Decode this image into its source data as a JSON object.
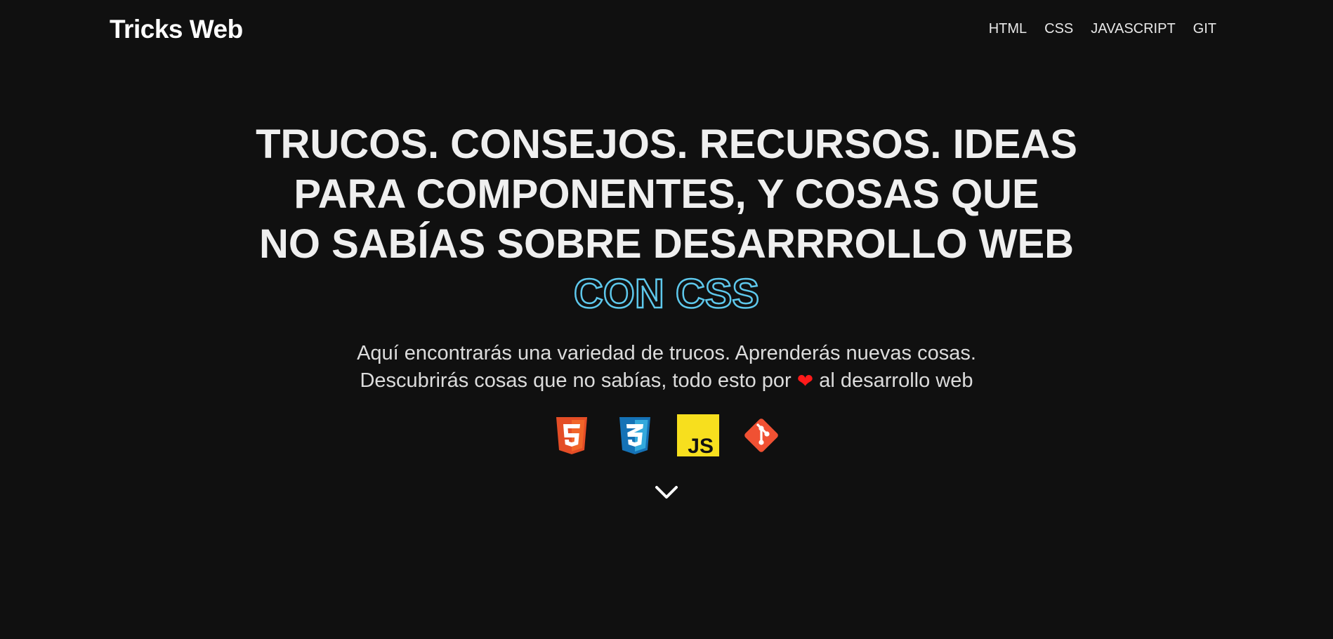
{
  "header": {
    "logo": "Tricks Web",
    "nav": [
      "HTML",
      "CSS",
      "JAVASCRIPT",
      "GIT"
    ]
  },
  "hero": {
    "headline_lines": [
      "TRUCOS. CONSEJOS. RECURSOS. IDEAS",
      "PARA COMPONENTES, Y COSAS QUE",
      "NO SABÍAS SOBRE DESARRROLLO WEB"
    ],
    "highlight": "CON CSS",
    "subtitle_line1": "Aquí encontrarás una variedad de trucos. Aprenderás nuevas cosas.",
    "subtitle_line2_before": "Descubrirás cosas que no sabías, todo esto por",
    "subtitle_line2_after": "al desarrollo web",
    "icons": [
      "html5-icon",
      "css3-icon",
      "javascript-icon",
      "git-icon"
    ]
  },
  "colors": {
    "background": "#101010",
    "text": "#efefef",
    "accent_outline": "#5ec8ec",
    "heart": "#ff1a1a",
    "html5": "#e44d26",
    "css3": "#1572b6",
    "javascript": "#f7df1e",
    "git": "#f05133"
  }
}
